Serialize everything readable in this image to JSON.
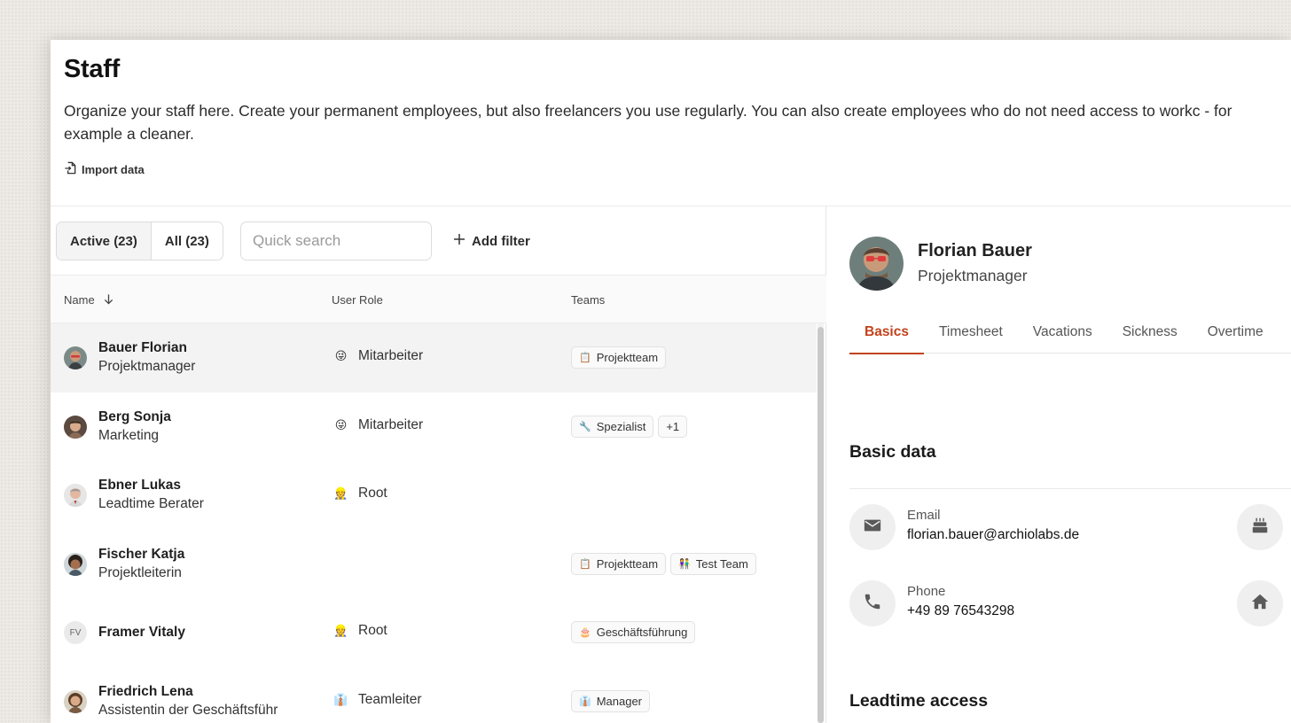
{
  "header": {
    "title": "Staff",
    "description": "Organize your staff here. Create your permanent employees, but also freelancers you use regularly. You can also create employees who do not need access to workc - for example a cleaner.",
    "import_label": "Import data"
  },
  "filters": {
    "active_label": "Active (23)",
    "all_label": "All (23)",
    "search_placeholder": "Quick search",
    "add_filter_label": "Add filter"
  },
  "table": {
    "columns": {
      "name": "Name",
      "role": "User Role",
      "teams": "Teams"
    },
    "rows": [
      {
        "name": "Bauer Florian",
        "subtitle": "Projektmanager",
        "role": "Mitarbeiter",
        "role_icon": "😜",
        "teams": [
          {
            "icon": "📋",
            "label": "Projektteam"
          }
        ]
      },
      {
        "name": "Berg Sonja",
        "subtitle": "Marketing",
        "role": "Mitarbeiter",
        "role_icon": "😜",
        "teams": [
          {
            "icon": "🔧",
            "label": "Spezialist"
          },
          {
            "icon": "",
            "label": "+1"
          }
        ]
      },
      {
        "name": "Ebner Lukas",
        "subtitle": "Leadtime Berater",
        "role": "Root",
        "role_icon": "👷",
        "teams": []
      },
      {
        "name": "Fischer Katja",
        "subtitle": "Projektleiterin",
        "role": "",
        "role_icon": "",
        "teams": [
          {
            "icon": "📋",
            "label": "Projektteam"
          },
          {
            "icon": "👫",
            "label": "Test Team"
          }
        ]
      },
      {
        "name": "Framer Vitaly",
        "subtitle": "",
        "initials": "FV",
        "role": "Root",
        "role_icon": "👷",
        "teams": [
          {
            "icon": "🎂",
            "label": "Geschäftsführung"
          }
        ]
      },
      {
        "name": "Friedrich Lena",
        "subtitle": "Assistentin der Geschäftsführ",
        "role": "Teamleiter",
        "role_icon": "👔",
        "teams": [
          {
            "icon": "👔",
            "label": "Manager"
          }
        ]
      }
    ]
  },
  "detail": {
    "name": "Florian Bauer",
    "role": "Projektmanager",
    "tabs": [
      "Basics",
      "Timesheet",
      "Vacations",
      "Sickness",
      "Overtime"
    ],
    "basic_data_title": "Basic data",
    "email_label": "Email",
    "email_value": "florian.bauer@archiolabs.de",
    "phone_label": "Phone",
    "phone_value": "+49 89 76543298",
    "access_title": "Leadtime access"
  },
  "colors": {
    "accent": "#c2431c",
    "selected_row": "#f3f3f3"
  }
}
